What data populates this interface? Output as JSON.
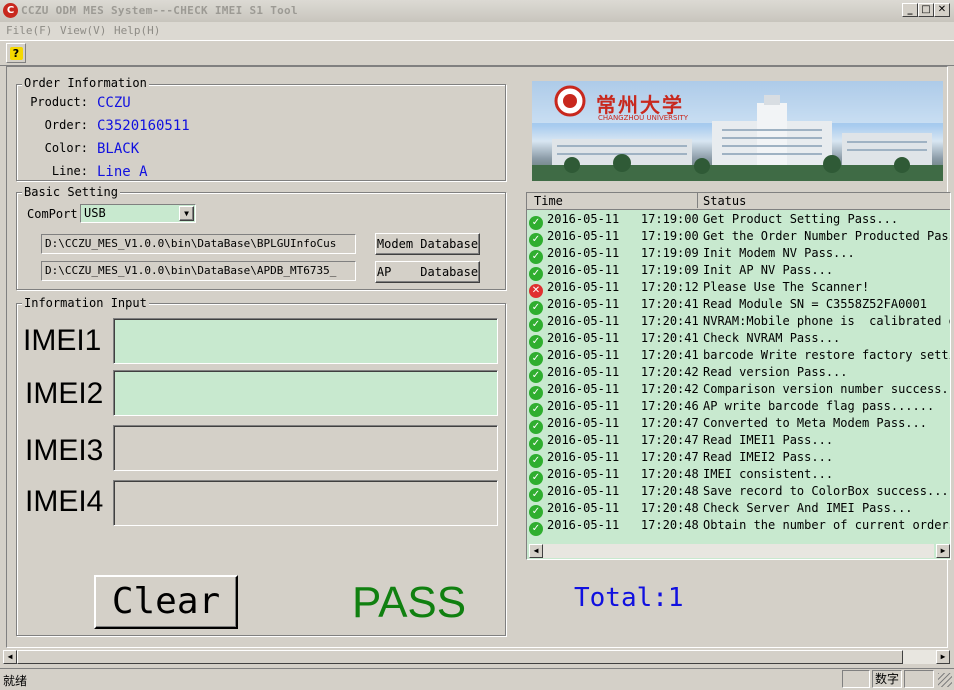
{
  "window": {
    "title": "CCZU ODM MES System---CHECK IMEI S1 Tool",
    "icon_text": "C",
    "controls": [
      "_",
      "□",
      "✕"
    ]
  },
  "menu": [
    "File(F)",
    "View(V)",
    "Help(H)"
  ],
  "toolbar": {
    "help_glyph": "?"
  },
  "order": {
    "legend": "Order Information",
    "product_label": "Product:",
    "product": "CCZU",
    "order_label": "Order:",
    "order": "C3520160511",
    "color_label": "Color:",
    "color": "BLACK",
    "line_label": "Line:",
    "line": "Line A"
  },
  "basic": {
    "legend": "Basic Setting",
    "comport_label": "ComPort",
    "comport_value": "USB",
    "modem_path": "D:\\CCZU_MES_V1.0.0\\bin\\DataBase\\BPLGUInfoCus",
    "ap_path": "D:\\CCZU_MES_V1.0.0\\bin\\DataBase\\APDB_MT6735_",
    "modem_button": "Modem Database",
    "ap_button": "AP    Database"
  },
  "input": {
    "legend": "Information Input",
    "imei1_label": "IMEI1",
    "imei2_label": "IMEI2",
    "imei3_label": "IMEI3",
    "imei4_label": "IMEI4"
  },
  "actions": {
    "clear_button": "Clear",
    "result": "PASS",
    "total": "Total:1"
  },
  "banner": {
    "logo_cn": "常州大学",
    "logo_en": "CHANGZHOU UNIVERSITY"
  },
  "log": {
    "headers": {
      "time": "Time",
      "status": "Status"
    },
    "rows": [
      {
        "t": "2016-05-11   17:19:00",
        "s": "Get Product Setting Pass...",
        "ok": true
      },
      {
        "t": "2016-05-11   17:19:00",
        "s": "Get the Order Number Producted Pass",
        "ok": true
      },
      {
        "t": "2016-05-11   17:19:09",
        "s": "Init Modem NV Pass...",
        "ok": true
      },
      {
        "t": "2016-05-11   17:19:09",
        "s": "Init AP NV Pass...",
        "ok": true
      },
      {
        "t": "2016-05-11   17:20:12",
        "s": "Please Use The Scanner!",
        "ok": false
      },
      {
        "t": "2016-05-11   17:20:41",
        "s": "Read Module SN = C3558Z52FA0001",
        "ok": true
      },
      {
        "t": "2016-05-11   17:20:41",
        "s": "NVRAM:Mobile phone is  calibrated o.",
        "ok": true
      },
      {
        "t": "2016-05-11   17:20:41",
        "s": "Check NVRAM Pass...",
        "ok": true
      },
      {
        "t": "2016-05-11   17:20:41",
        "s": "barcode Write restore factory setti.",
        "ok": true
      },
      {
        "t": "2016-05-11   17:20:42",
        "s": "Read version Pass...",
        "ok": true
      },
      {
        "t": "2016-05-11   17:20:42",
        "s": "Comparison version number success...",
        "ok": true
      },
      {
        "t": "2016-05-11   17:20:46",
        "s": "AP write barcode flag pass......",
        "ok": true
      },
      {
        "t": "2016-05-11   17:20:47",
        "s": "Converted to Meta Modem Pass...",
        "ok": true
      },
      {
        "t": "2016-05-11   17:20:47",
        "s": "Read IMEI1 Pass...",
        "ok": true
      },
      {
        "t": "2016-05-11   17:20:47",
        "s": "Read IMEI2 Pass...",
        "ok": true
      },
      {
        "t": "2016-05-11   17:20:48",
        "s": "IMEI consistent...",
        "ok": true
      },
      {
        "t": "2016-05-11   17:20:48",
        "s": "Save record to ColorBox success...",
        "ok": true
      },
      {
        "t": "2016-05-11   17:20:48",
        "s": "Check Server And IMEI Pass...",
        "ok": true
      },
      {
        "t": "2016-05-11   17:20:48",
        "s": "Obtain the number of current orders.",
        "ok": true
      }
    ]
  },
  "statusbar": {
    "left": "就绪",
    "num": "数字"
  },
  "colors": {
    "value_blue": "#1010e0",
    "pass_green": "#108010",
    "total_blue": "#1010e0",
    "field_green": "#c8e9cf"
  }
}
